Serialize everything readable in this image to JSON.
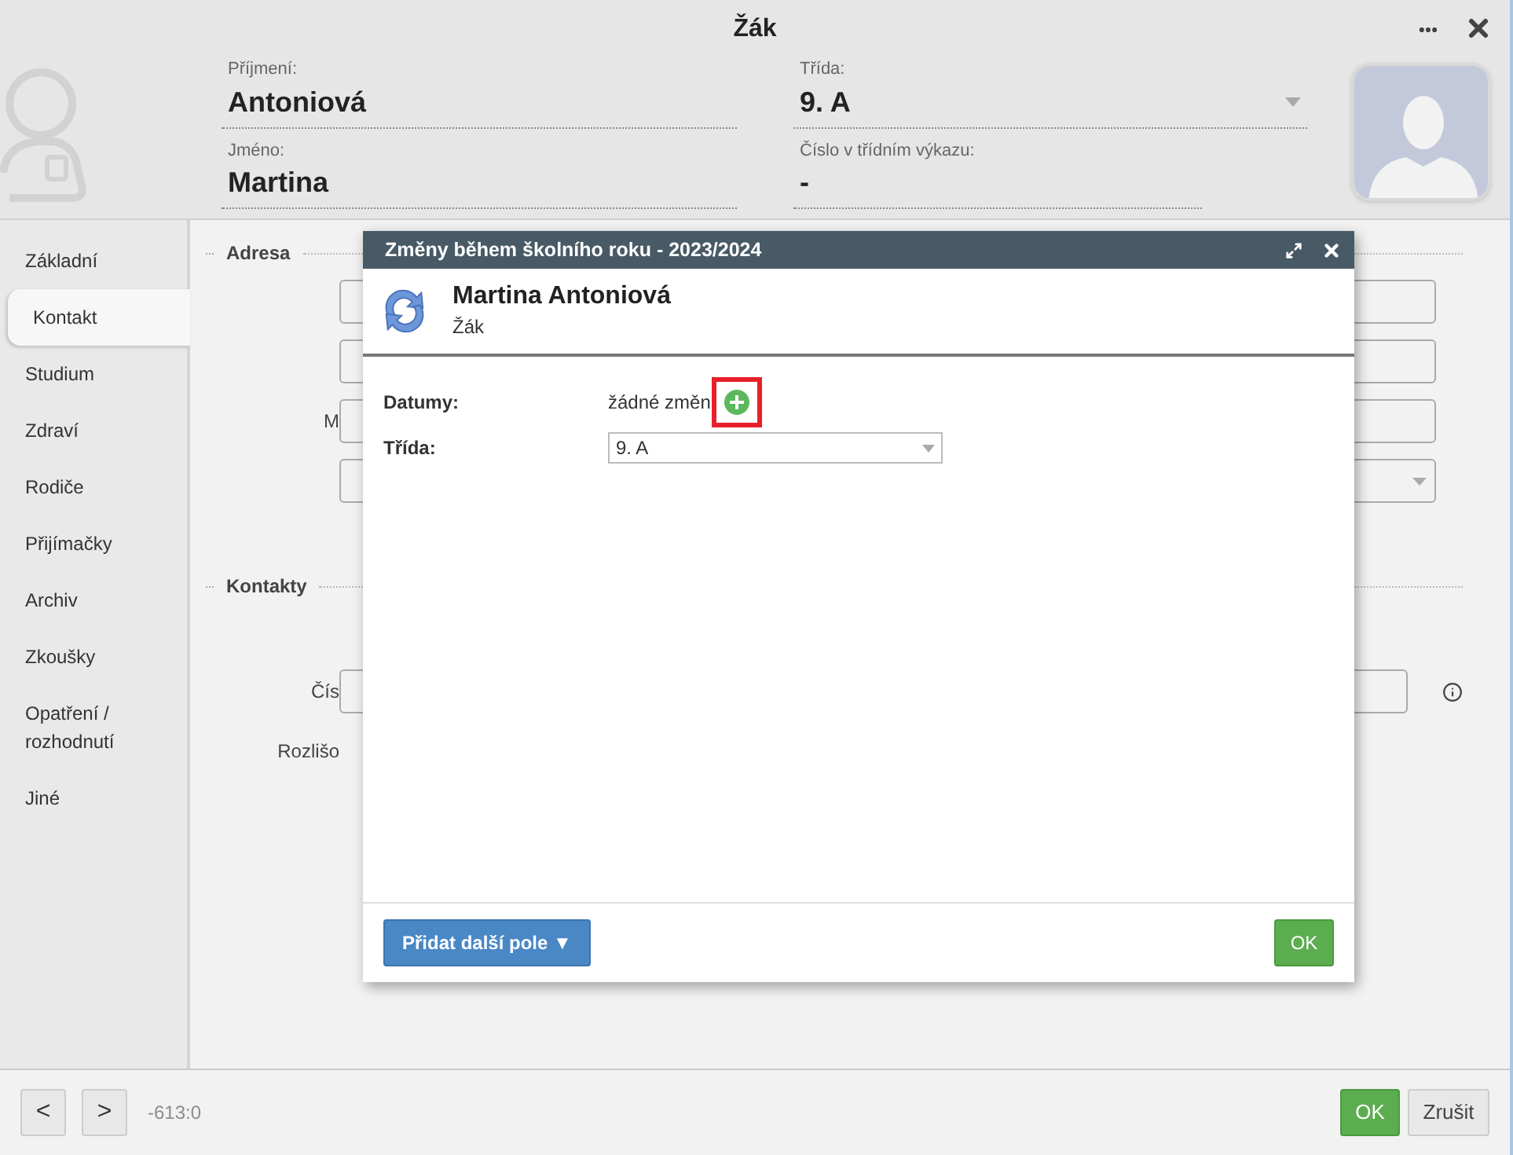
{
  "window": {
    "title": "Žák"
  },
  "header": {
    "left_fields": [
      {
        "label": "Příjmení:",
        "value": "Antoniová"
      },
      {
        "label": "Jméno:",
        "value": "Martina"
      }
    ],
    "right_fields": [
      {
        "label": "Třída:",
        "value": "9. A",
        "kind": "select"
      },
      {
        "label": "Číslo v třídním výkazu:",
        "value": "-",
        "kind": "text"
      }
    ]
  },
  "sidebar": {
    "items": [
      {
        "label": "Základní",
        "selected": false
      },
      {
        "label": "Kontakt",
        "selected": true
      },
      {
        "label": "Studium",
        "selected": false
      },
      {
        "label": "Zdraví",
        "selected": false
      },
      {
        "label": "Rodiče",
        "selected": false
      },
      {
        "label": "Přijímačky",
        "selected": false
      },
      {
        "label": "Archiv",
        "selected": false
      },
      {
        "label": "Zkoušky",
        "selected": false
      },
      {
        "label": "Opatření / rozhodnutí",
        "selected": false
      },
      {
        "label": "Jiné",
        "selected": false
      }
    ]
  },
  "form": {
    "sections": [
      {
        "legend": "Adresa",
        "rows": [
          {
            "kind": "input"
          },
          {
            "kind": "input"
          },
          {
            "kind": "input",
            "label": "M"
          },
          {
            "kind": "select"
          }
        ]
      },
      {
        "legend": "Kontakty",
        "rows": [
          {
            "kind": "input",
            "label": "Čís",
            "info": true
          },
          {
            "kind": "label",
            "label": "Rozlišo"
          }
        ]
      }
    ]
  },
  "dialog": {
    "title": "Změny během školního roku - 2023/2024",
    "person": {
      "name": "Martina Antoniová",
      "role": "Žák"
    },
    "rows": [
      {
        "label": "Datumy:",
        "kind": "text",
        "value": "žádné změn"
      },
      {
        "label": "Třída:",
        "kind": "select",
        "value": "9. A"
      }
    ],
    "add_button": "Přidat další pole ▼",
    "ok_button": "OK"
  },
  "footer": {
    "prev": "<",
    "next": ">",
    "position": "-613:0",
    "ok": "OK",
    "cancel": "Zrušit"
  }
}
